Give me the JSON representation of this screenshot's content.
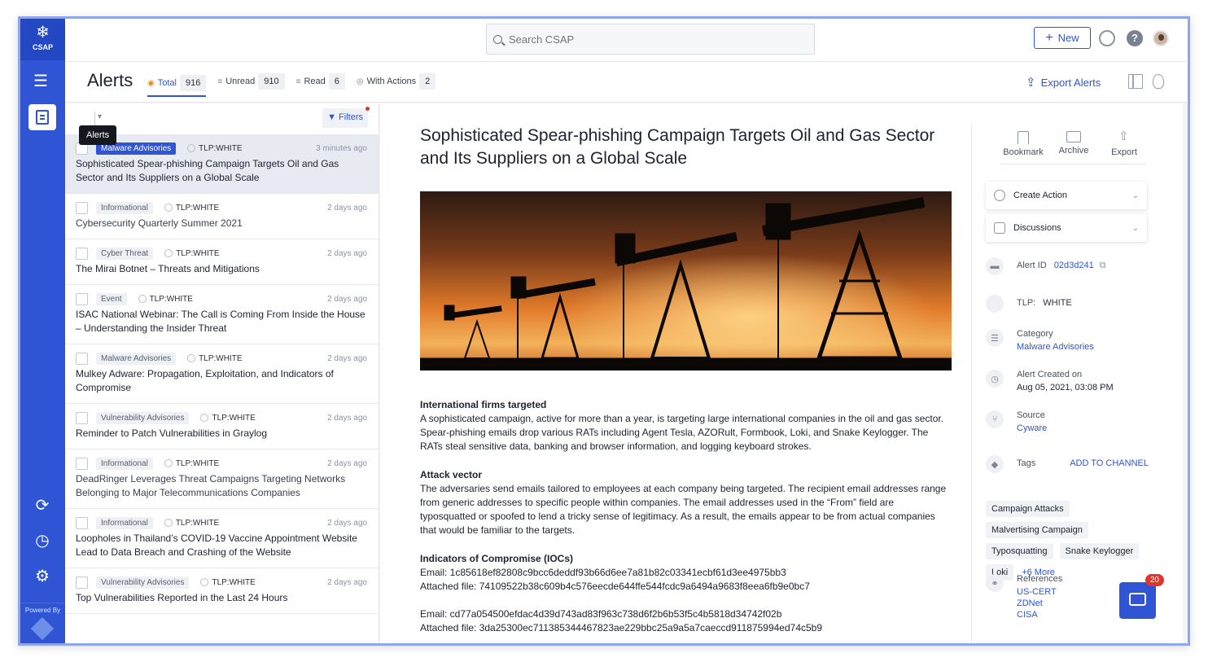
{
  "app": {
    "logo_text": "CSAP",
    "powered_by": "Powered By"
  },
  "search": {
    "placeholder": "Search CSAP"
  },
  "topbar": {
    "new_label": "New"
  },
  "tooltip": {
    "text": "Alerts"
  },
  "header": {
    "title": "Alerts",
    "tabs": [
      {
        "label": "Total",
        "count": "916"
      },
      {
        "label": "Unread",
        "count": "910"
      },
      {
        "label": "Read",
        "count": "6"
      },
      {
        "label": "With Actions",
        "count": "2"
      }
    ],
    "export_label": "Export Alerts"
  },
  "list": {
    "filters_label": "Filters",
    "items": [
      {
        "category": "Malware Advisories",
        "tlp": "TLP:WHITE",
        "time": "3 minutes ago",
        "title": "Sophisticated Spear-phishing Campaign Targets Oil and Gas Sector and Its Suppliers on a Global Scale"
      },
      {
        "category": "Informational",
        "tlp": "TLP:WHITE",
        "time": "2 days ago",
        "title": "Cybersecurity Quarterly Summer 2021"
      },
      {
        "category": "Cyber Threat",
        "tlp": "TLP:WHITE",
        "time": "2 days ago",
        "title": "The Mirai Botnet – Threats and Mitigations"
      },
      {
        "category": "Event",
        "tlp": "TLP:WHITE",
        "time": "2 days ago",
        "title": "ISAC National Webinar: The Call is Coming From Inside the House – Understanding the Insider Threat"
      },
      {
        "category": "Malware Advisories",
        "tlp": "TLP:WHITE",
        "time": "2 days ago",
        "title": "Mulkey Adware: Propagation, Exploitation, and Indicators of Compromise"
      },
      {
        "category": "Vulnerability Advisories",
        "tlp": "TLP:WHITE",
        "time": "2 days ago",
        "title": "Reminder to Patch Vulnerabilities in Graylog"
      },
      {
        "category": "Informational",
        "tlp": "TLP:WHITE",
        "time": "2 days ago",
        "title": "DeadRinger Leverages Threat Campaigns Targeting Networks Belonging to Major Telecommunications Companies"
      },
      {
        "category": "Informational",
        "tlp": "TLP:WHITE",
        "time": "2 days ago",
        "title": "Loopholes in Thailand’s COVID-19 Vaccine Appointment Website Lead to Data Breach and Crashing of the Website"
      },
      {
        "category": "Vulnerability Advisories",
        "tlp": "TLP:WHITE",
        "time": "2 days ago",
        "title": "Top Vulnerabilities Reported in the Last 24 Hours"
      }
    ]
  },
  "article": {
    "title": "Sophisticated Spear-phishing Campaign Targets Oil and Gas Sector and Its Suppliers on a Global Scale",
    "sections": [
      {
        "heading": "International firms targeted",
        "text": "A sophisticated campaign, active for more than a year, is targeting large international companies in the oil and gas sector. Spear-phishing emails drop various RATs including Agent Tesla, AZORult, Formbook, Loki, and Snake Keylogger. The RATs steal sensitive data, banking and browser information, and logging keyboard strokes."
      },
      {
        "heading": "Attack vector",
        "text": "The adversaries send emails tailored to employees at each company being targeted. The recipient email addresses range from generic addresses to specific people within companies. The email addresses used in the “From” field are typosquatted or spoofed to lend a tricky sense of legitimacy. As a result, the emails appear to be from actual companies that would be familiar to the targets."
      }
    ],
    "ioc_heading": "Indicators of Compromise (IOCs)",
    "iocs": [
      {
        "email": "Email: 1c85618ef82808c9bcc6deddf93b66d6ee7a81b82c03341ecbf61d3ee4975bb3",
        "file": "Attached file: 74109522b38c609b4c576eecde644ffe544fcdc9a6494a9683f8eea6fb9e0bc7"
      },
      {
        "email": "Email: cd77a054500efdac4d39d743ad83f963c738d6f2b6b53f5c4b5818d34742f02b",
        "file": "Attached file: 3da25300ec711385344467823ae229bbc25a9a5a7caeccd911875994ed74c5b9"
      }
    ]
  },
  "sidebar": {
    "actions": {
      "bookmark": "Bookmark",
      "archive": "Archive",
      "export": "Export"
    },
    "create_action": "Create Action",
    "discussions": "Discussions",
    "alert_id_label": "Alert ID",
    "alert_id": "02d3d241",
    "tlp_label": "TLP:",
    "tlp_value": "WHITE",
    "category_label": "Category",
    "category_value": "Malware Advisories",
    "created_label": "Alert Created on",
    "created_value": "Aug 05, 2021, 03:08 PM",
    "source_label": "Source",
    "source_value": "Cyware",
    "tags_label": "Tags",
    "add_to_channel": "ADD TO CHANNEL",
    "tags": [
      "Campaign Attacks",
      "Malvertising Campaign",
      "Typosquatting",
      "Snake Keylogger",
      "Loki"
    ],
    "tags_more": "+6 More",
    "references_label": "References",
    "references": [
      "US-CERT",
      "ZDNet",
      "CISA"
    ]
  },
  "chat": {
    "badge": "20"
  },
  "colors": {
    "brand": "#2f55d4",
    "badge": "#e0352f"
  }
}
